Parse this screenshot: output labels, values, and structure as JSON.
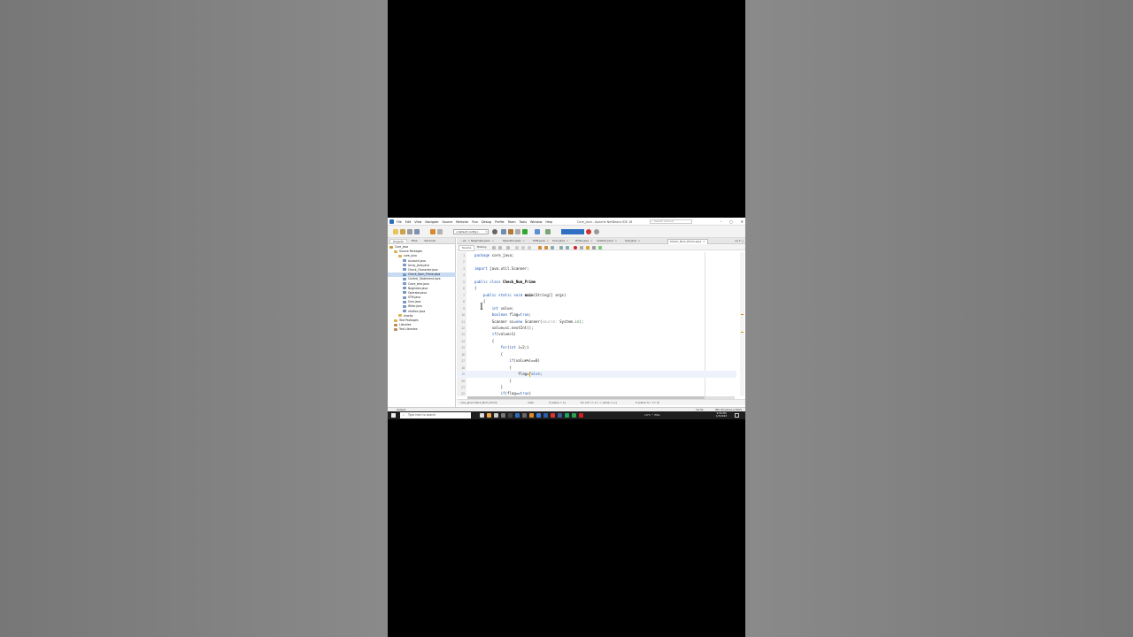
{
  "window": {
    "title": "Core_java - Apache NetBeans IDE 16",
    "search_placeholder": "Search (Ctrl+I)"
  },
  "menu": [
    "File",
    "Edit",
    "View",
    "Navigate",
    "Source",
    "Refactor",
    "Run",
    "Debug",
    "Profile",
    "Team",
    "Tools",
    "Window",
    "Help"
  ],
  "toolbar": {
    "config": "<default config>"
  },
  "projects_panel": {
    "tabs": [
      "Projects",
      "Files",
      "Services"
    ],
    "tree": [
      {
        "label": "Core_java",
        "depth": 0,
        "type": "proj"
      },
      {
        "label": "Source Packages",
        "depth": 1,
        "type": "pkg"
      },
      {
        "label": "core_java",
        "depth": 2,
        "type": "pkg"
      },
      {
        "label": "Account.java",
        "depth": 3,
        "type": "java"
      },
      {
        "label": "Array_Jana.java",
        "depth": 3,
        "type": "java"
      },
      {
        "label": "Check_Character.java",
        "depth": 3,
        "type": "java"
      },
      {
        "label": "Check_Num_Prime.java",
        "depth": 3,
        "type": "java",
        "selected": true
      },
      {
        "label": "Control_Statement.java",
        "depth": 3,
        "type": "java"
      },
      {
        "label": "Crore_tera.java",
        "depth": 3,
        "type": "java"
      },
      {
        "label": "NegIndex.java",
        "depth": 3,
        "type": "java"
      },
      {
        "label": "Operator.java",
        "depth": 3,
        "type": "java"
      },
      {
        "label": "STM.java",
        "depth": 3,
        "type": "java"
      },
      {
        "label": "Sum.java",
        "depth": 3,
        "type": "java"
      },
      {
        "label": "Write.java",
        "depth": 3,
        "type": "java"
      },
      {
        "label": "relation.java",
        "depth": 3,
        "type": "java"
      },
      {
        "label": "shortly",
        "depth": 2,
        "type": "pkg"
      },
      {
        "label": "Test Packages",
        "depth": 1,
        "type": "pkg"
      },
      {
        "label": "Libraries",
        "depth": 1,
        "type": "lib"
      },
      {
        "label": "Test Libraries",
        "depth": 1,
        "type": "lib"
      }
    ]
  },
  "editor": {
    "tabs": [
      {
        "label": "...va"
      },
      {
        "label": "NegIndex.java"
      },
      {
        "label": "Operator.java"
      },
      {
        "label": "STM.java"
      },
      {
        "label": "Sum.java"
      },
      {
        "label": "Write.java"
      },
      {
        "label": "relation.java"
      },
      {
        "label": "Sub.java"
      },
      {
        "label": "Check_Num_Prime.java",
        "active": true
      }
    ],
    "subtabs": [
      "Source",
      "History"
    ],
    "lines": [
      {
        "n": "1",
        "html": "<span class=\"kw\">package</span> core_java;"
      },
      {
        "n": "2",
        "html": ""
      },
      {
        "n": "3",
        "html": "<span class=\"kw\">import</span> java.util.Scanner;"
      },
      {
        "n": "4",
        "html": ""
      },
      {
        "n": "5",
        "html": "<span class=\"kw\">public class</span> <span class=\"cls\">Check_Num_Prime</span>"
      },
      {
        "n": "6",
        "html": "{"
      },
      {
        "n": "7",
        "html": "    <span class=\"kw\">public static void</span> <span class=\"mth\">main</span>(String[] args)"
      },
      {
        "n": "8",
        "html": "    {"
      },
      {
        "n": "9",
        "html": "        <span class=\"kw\">int</span> value;"
      },
      {
        "n": "10",
        "html": "        <span class=\"kw\">boolean</span> flag=<span class=\"kw\">true</span>;"
      },
      {
        "n": "11",
        "html": "        Scanner sc=<span class=\"kw\">new</span> Scanner(<span class=\"cmt\">source:</span> System.<span class=\"fld\">in</span>);"
      },
      {
        "n": "12",
        "html": "        value=sc.nextInt();"
      },
      {
        "n": "13",
        "html": "        <span class=\"kw\">if</span>(value>1)"
      },
      {
        "n": "14",
        "html": "        {"
      },
      {
        "n": "15",
        "html": "            <span class=\"kw\">for</span>(<span class=\"kw\">int</span> i=2;i<value;i++)"
      },
      {
        "n": "16",
        "html": "            {"
      },
      {
        "n": "17",
        "html": "                <span class=\"kw\">if</span>(value%i==0)"
      },
      {
        "n": "18",
        "html": "                {"
      },
      {
        "n": "19",
        "html": "                    flag=<span class=\"kw\">false</span>;",
        "current": true
      },
      {
        "n": "20",
        "html": "                }"
      },
      {
        "n": "21",
        "html": "            }"
      },
      {
        "n": "22",
        "html": "            <span class=\"kw\">if</span>(flag==<span class=\"kw\">true</span>)"
      }
    ],
    "breadcrumbs": [
      "core_java.Check_Num_Prime",
      "main",
      "if (value > 1)",
      "for (int i = 2; i < value; i++)",
      "if (value % i == 0)"
    ]
  },
  "statusbar": {
    "output": "Output",
    "position": "19:31",
    "mode": "INS Windows (CRLF)"
  },
  "taskbar": {
    "search_placeholder": "Type here to search",
    "tray": "19°C  ^  ENG",
    "time": "9:59 PM",
    "date": "1/7/2023"
  }
}
